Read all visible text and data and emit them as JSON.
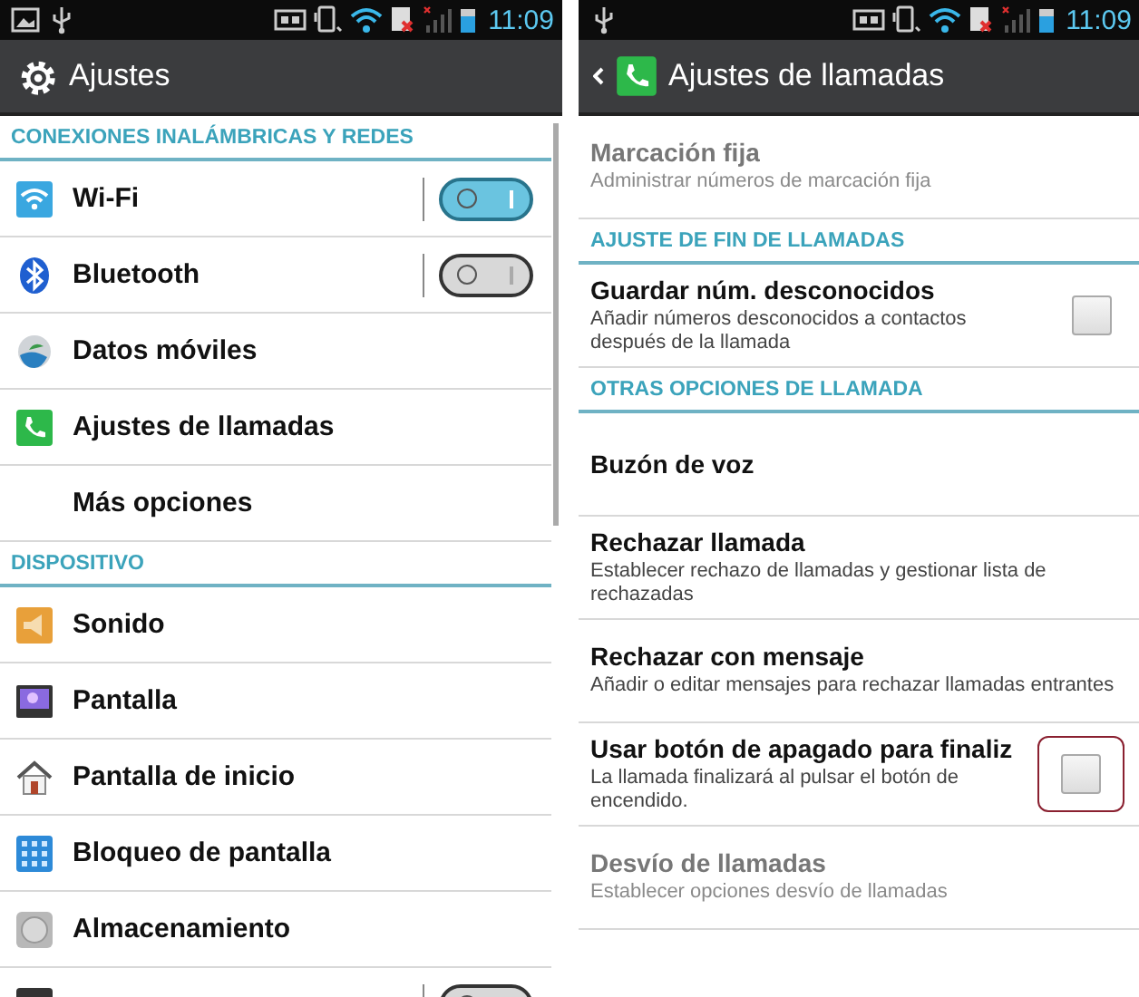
{
  "screens": [
    {
      "status_bar": {
        "time": "11:09"
      },
      "action_bar": {
        "title": "Ajustes"
      },
      "items": [
        {
          "kind": "header",
          "title": "CONEXIONES INALÁMBRICAS Y REDES"
        },
        {
          "kind": "toggle",
          "title": "Wi-Fi",
          "on": true
        },
        {
          "kind": "toggle",
          "title": "Bluetooth",
          "on": false
        },
        {
          "kind": "item",
          "title": "Datos móviles"
        },
        {
          "kind": "item",
          "title": "Ajustes de llamadas"
        },
        {
          "kind": "item",
          "title": "Más opciones"
        },
        {
          "kind": "header",
          "title": "DISPOSITIVO"
        },
        {
          "kind": "item",
          "title": "Sonido"
        },
        {
          "kind": "item",
          "title": "Pantalla"
        },
        {
          "kind": "item",
          "title": "Pantalla de inicio"
        },
        {
          "kind": "item",
          "title": "Bloqueo de pantalla"
        },
        {
          "kind": "item",
          "title": "Almacenamiento"
        },
        {
          "kind": "toggle",
          "on": false
        }
      ]
    },
    {
      "status_bar": {
        "time": "11:09"
      },
      "action_bar": {
        "title": "Ajustes de llamadas"
      },
      "items": [
        {
          "kind": "item",
          "title": "Marcación fija",
          "subtitle": "Administrar números de marcación fija",
          "disabled": true
        },
        {
          "kind": "header",
          "title": "AJUSTE DE FIN DE LLAMADAS"
        },
        {
          "kind": "checkbox",
          "title": "Guardar núm. desconocidos",
          "subtitle": "Añadir números desconocidos a contactos después de la llamada",
          "checked": false,
          "highlighted": false
        },
        {
          "kind": "header",
          "title": "OTRAS OPCIONES DE LLAMADA"
        },
        {
          "kind": "item",
          "title": "Buzón de voz"
        },
        {
          "kind": "item",
          "title": "Rechazar llamada",
          "subtitle": "Establecer rechazo de llamadas y gestionar lista de rechazadas"
        },
        {
          "kind": "item",
          "title": "Rechazar con mensaje",
          "subtitle": "Añadir o editar mensajes para rechazar llamadas entrantes"
        },
        {
          "kind": "checkbox",
          "title": "Usar botón de apagado para finaliz",
          "subtitle": "La llamada finalizará al pulsar el botón de encendido.",
          "checked": false,
          "highlighted": true
        },
        {
          "kind": "item",
          "title": "Desvío de llamadas",
          "subtitle": "Establecer opciones desvío de llamadas",
          "disabled": true
        }
      ]
    }
  ]
}
